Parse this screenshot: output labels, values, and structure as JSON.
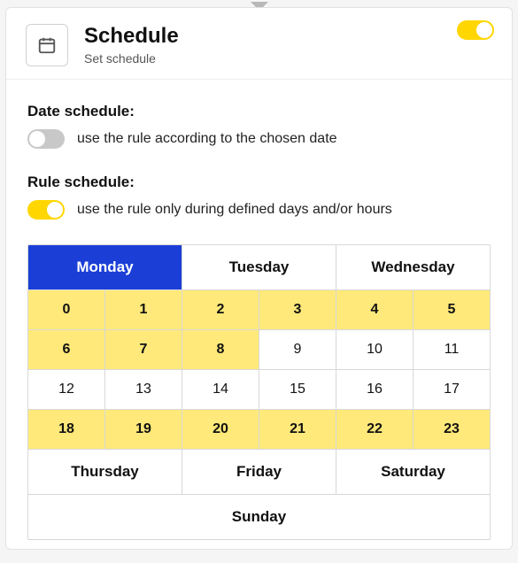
{
  "header": {
    "title": "Schedule",
    "subtitle": "Set schedule",
    "enabled": true
  },
  "date_schedule": {
    "label": "Date schedule:",
    "enabled": false,
    "desc": "use the rule according to the chosen date"
  },
  "rule_schedule": {
    "label": "Rule schedule:",
    "enabled": true,
    "desc": "use the rule only during defined days and/or hours"
  },
  "days": {
    "mon": "Monday",
    "tue": "Tuesday",
    "wed": "Wednesday",
    "thu": "Thursday",
    "fri": "Friday",
    "sat": "Saturday",
    "sun": "Sunday"
  },
  "hours": {
    "h0": "0",
    "h1": "1",
    "h2": "2",
    "h3": "3",
    "h4": "4",
    "h5": "5",
    "h6": "6",
    "h7": "7",
    "h8": "8",
    "h9": "9",
    "h10": "10",
    "h11": "11",
    "h12": "12",
    "h13": "13",
    "h14": "14",
    "h15": "15",
    "h16": "16",
    "h17": "17",
    "h18": "18",
    "h19": "19",
    "h20": "20",
    "h21": "21",
    "h22": "22",
    "h23": "23"
  },
  "selected_hours": [
    0,
    1,
    2,
    3,
    4,
    5,
    6,
    7,
    8,
    18,
    19,
    20,
    21,
    22,
    23
  ],
  "active_day": "mon"
}
